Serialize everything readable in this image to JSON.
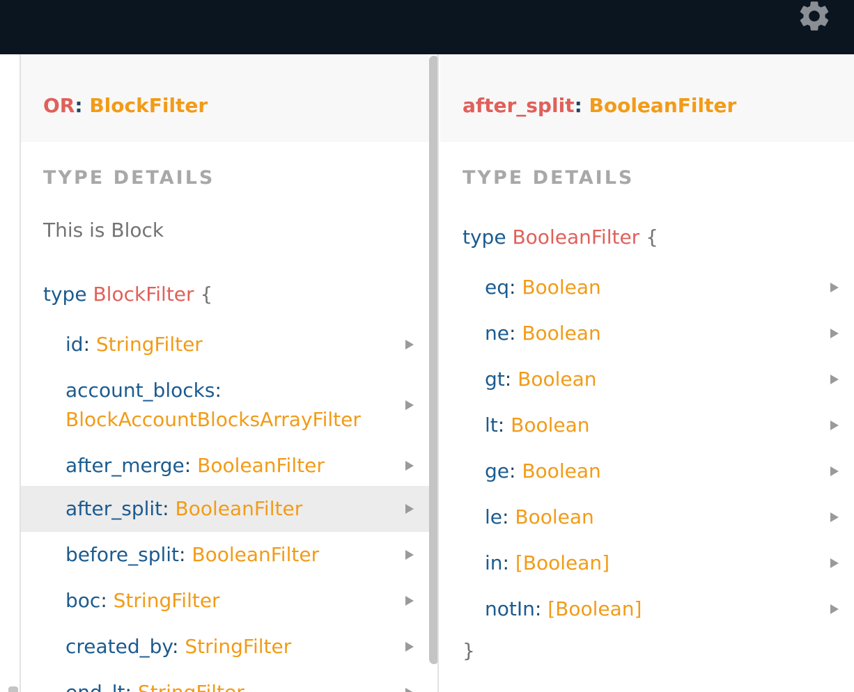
{
  "topbar": {
    "settings_icon": "gear-icon"
  },
  "left_panel": {
    "title_field": "OR",
    "title_sep": ": ",
    "title_type": "BlockFilter",
    "section_title": "TYPE DETAILS",
    "description": "This is Block",
    "type_keyword": "type",
    "type_name": "BlockFilter",
    "open_brace": "{",
    "fields": [
      {
        "name": "id",
        "sep": ": ",
        "type": "StringFilter"
      },
      {
        "name": "account_blocks",
        "sep": ":",
        "type": "BlockAccountBlocksArrayFilter"
      },
      {
        "name": "after_merge",
        "sep": ": ",
        "type": "BooleanFilter"
      },
      {
        "name": "after_split",
        "sep": ": ",
        "type": "BooleanFilter"
      },
      {
        "name": "before_split",
        "sep": ": ",
        "type": "BooleanFilter"
      },
      {
        "name": "boc",
        "sep": ": ",
        "type": "StringFilter"
      },
      {
        "name": "created_by",
        "sep": ": ",
        "type": "StringFilter"
      },
      {
        "name": "end_lt",
        "sep": ": ",
        "type": "StringFilter"
      }
    ]
  },
  "right_panel": {
    "title_field": "after_split",
    "title_sep": ": ",
    "title_type": "BooleanFilter",
    "section_title": "TYPE DETAILS",
    "type_keyword": "type",
    "type_name": "BooleanFilter",
    "open_brace": "{",
    "close_brace": "}",
    "fields": [
      {
        "name": "eq",
        "sep": ": ",
        "type": "Boolean"
      },
      {
        "name": "ne",
        "sep": ": ",
        "type": "Boolean"
      },
      {
        "name": "gt",
        "sep": ": ",
        "type": "Boolean"
      },
      {
        "name": "lt",
        "sep": ": ",
        "type": "Boolean"
      },
      {
        "name": "ge",
        "sep": ": ",
        "type": "Boolean"
      },
      {
        "name": "le",
        "sep": ": ",
        "type": "Boolean"
      },
      {
        "name": "in",
        "sep": ": ",
        "type": "[Boolean]"
      },
      {
        "name": "notIn",
        "sep": ": ",
        "type": "[Boolean]"
      }
    ]
  },
  "colors": {
    "topbar": "#0b1520",
    "field_name": "#e0605a",
    "type_name": "#f29b17",
    "keyword": "#1c5b8f",
    "active_row": "#ececec"
  }
}
